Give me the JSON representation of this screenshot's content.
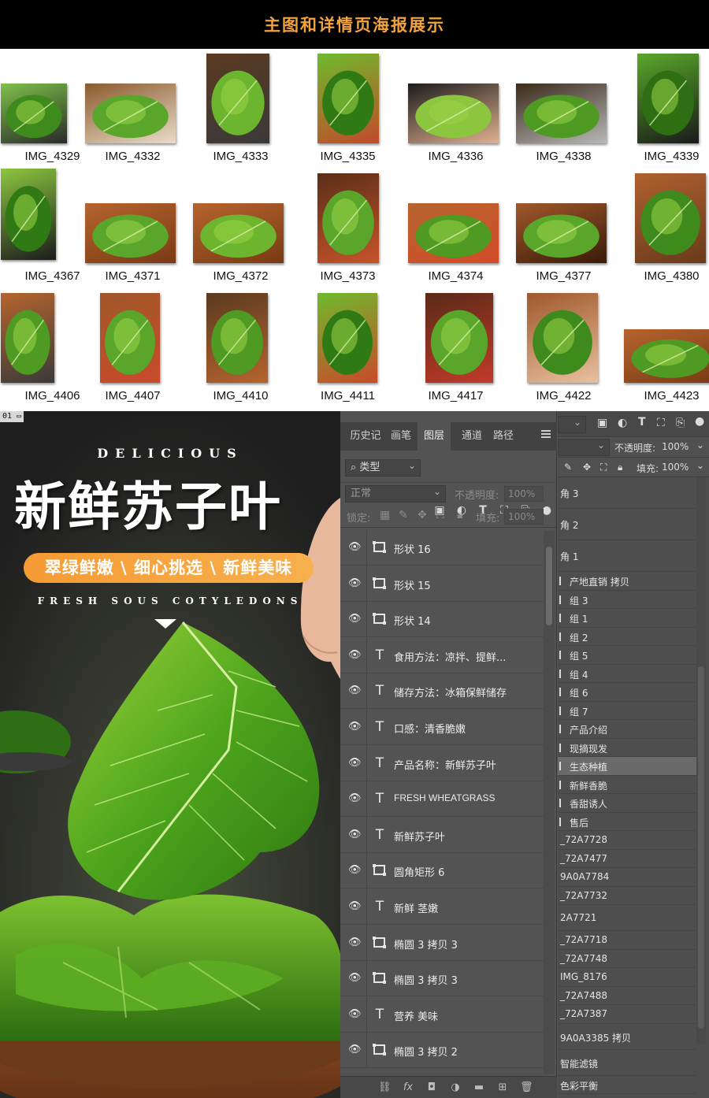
{
  "banner": {
    "title": "主图和详情页海报展示"
  },
  "thumbnails": [
    {
      "label": "IMG_4329"
    },
    {
      "label": "IMG_4332"
    },
    {
      "label": "IMG_4333"
    },
    {
      "label": "IMG_4335"
    },
    {
      "label": "IMG_4336"
    },
    {
      "label": "IMG_4338"
    },
    {
      "label": "IMG_4339"
    },
    {
      "label": "IMG_4367"
    },
    {
      "label": "IMG_4371"
    },
    {
      "label": "IMG_4372"
    },
    {
      "label": "IMG_4373"
    },
    {
      "label": "IMG_4374"
    },
    {
      "label": "IMG_4377"
    },
    {
      "label": "IMG_4380"
    },
    {
      "label": "IMG_4406"
    },
    {
      "label": "IMG_4407"
    },
    {
      "label": "IMG_4410"
    },
    {
      "label": "IMG_4411"
    },
    {
      "label": "IMG_4417"
    },
    {
      "label": "IMG_4422"
    },
    {
      "label": "IMG_4423"
    }
  ],
  "poster": {
    "doc_tab": "01",
    "delicious": "DELICIOUS",
    "title": "新鲜苏子叶",
    "pill": "翠绿鲜嫩 \\ 细心挑选 \\ 新鲜美味",
    "subtitle": "FRESH SOUS COTYLEDONS"
  },
  "photoshop": {
    "tabs": [
      "历史记",
      "画笔",
      "图层",
      "通道",
      "路径"
    ],
    "active_tab": "图层",
    "filter": {
      "label": "类型"
    },
    "blend": {
      "mode": "正常",
      "opacity_label": "不透明度:",
      "opacity": "100%",
      "lock_label": "锁定:",
      "fill_label": "填充:",
      "fill": "100%"
    },
    "layers": [
      {
        "type": "shape",
        "name": "形状 16"
      },
      {
        "type": "shape",
        "name": "形状 15"
      },
      {
        "type": "shape",
        "name": "形状 14"
      },
      {
        "type": "text",
        "name": "食用方法：凉拌、提鲜..."
      },
      {
        "type": "text",
        "name": "储存方法：冰箱保鲜储存"
      },
      {
        "type": "text",
        "name": "口感：清香脆嫩"
      },
      {
        "type": "text",
        "name": "产品名称：新鲜苏子叶"
      },
      {
        "type": "text",
        "name": "FRESH WHEATGRASS"
      },
      {
        "type": "text",
        "name": "新鲜苏子叶"
      },
      {
        "type": "shape",
        "name": "圆角矩形 6"
      },
      {
        "type": "text",
        "name": "新鲜 茎嫩"
      },
      {
        "type": "shape",
        "name": "椭圆 3 拷贝 3"
      },
      {
        "type": "shape",
        "name": "椭圆 3 拷贝 3"
      },
      {
        "type": "text",
        "name": "营养 美味"
      },
      {
        "type": "shape",
        "name": "椭圆 3 拷贝 2"
      }
    ],
    "right_panel": {
      "opacity_label": "不透明度:",
      "opacity": "100%",
      "fill_label": "填充:",
      "fill": "100%",
      "items": [
        {
          "name": "角 3",
          "style": "big"
        },
        {
          "name": "角 2",
          "style": "big"
        },
        {
          "name": "角 1",
          "style": "big"
        },
        {
          "name": "产地直销 拷贝",
          "style": "bar"
        },
        {
          "name": "组 3",
          "style": "bar"
        },
        {
          "name": "组 1",
          "style": "bar"
        },
        {
          "name": "组 2",
          "style": "bar"
        },
        {
          "name": "组 5",
          "style": "bar"
        },
        {
          "name": "组 4",
          "style": "bar"
        },
        {
          "name": "组 6",
          "style": "bar"
        },
        {
          "name": "组 7",
          "style": "bar"
        },
        {
          "name": "产品介绍",
          "style": "bar"
        },
        {
          "name": "现摘现发",
          "style": "bar"
        },
        {
          "name": "生态种植",
          "style": "bar-hl"
        },
        {
          "name": "新鲜香脆",
          "style": "bar"
        },
        {
          "name": "香甜诱人",
          "style": "bar"
        },
        {
          "name": "售后",
          "style": "bar"
        },
        {
          "name": "_72A7728",
          "style": "plain"
        },
        {
          "name": "_72A7477",
          "style": "plain"
        },
        {
          "name": "9A0A7784",
          "style": "plain"
        },
        {
          "name": "_72A7732",
          "style": "plain"
        },
        {
          "name": "2A7721",
          "style": "plainbig"
        },
        {
          "name": "_72A7718",
          "style": "plain"
        },
        {
          "name": "_72A7748",
          "style": "plain"
        },
        {
          "name": "IMG_8176",
          "style": "plain"
        },
        {
          "name": "_72A7488",
          "style": "plain"
        },
        {
          "name": "_72A7387",
          "style": "plain"
        },
        {
          "name": "9A0A3385 拷贝",
          "style": "plainbig"
        },
        {
          "name": "智能滤镜",
          "style": "plainbig"
        },
        {
          "name": "色彩平衡",
          "style": "plain"
        }
      ]
    }
  }
}
